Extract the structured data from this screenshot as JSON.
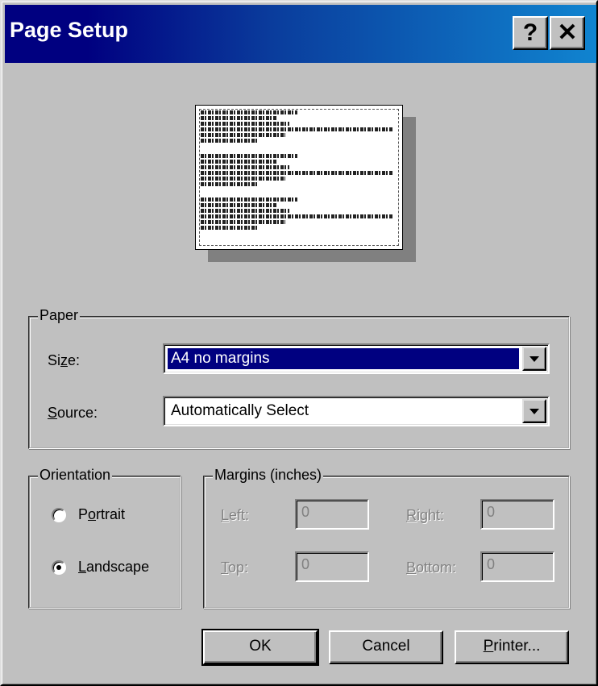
{
  "window": {
    "title": "Page Setup",
    "help_glyph": "?",
    "close_glyph": "✕"
  },
  "paper": {
    "group_label": "Paper",
    "size_label": "Size:",
    "size_value": "A4 no margins",
    "source_label": "Source:",
    "source_value": "Automatically Select"
  },
  "orientation": {
    "group_label": "Orientation",
    "portrait_label": "Portrait",
    "landscape_label": "Landscape",
    "selected": "Landscape"
  },
  "margins": {
    "group_label": "Margins (inches)",
    "left_label": "Left:",
    "left_value": "0",
    "right_label": "Right:",
    "right_value": "0",
    "top_label": "Top:",
    "top_value": "0",
    "bottom_label": "Bottom:",
    "bottom_value": "0"
  },
  "buttons": {
    "ok": "OK",
    "cancel": "Cancel",
    "printer": "Printer..."
  },
  "colors": {
    "title_start": "#000080",
    "title_end": "#1084d0",
    "face": "#c0c0c0",
    "selection": "#000080"
  }
}
